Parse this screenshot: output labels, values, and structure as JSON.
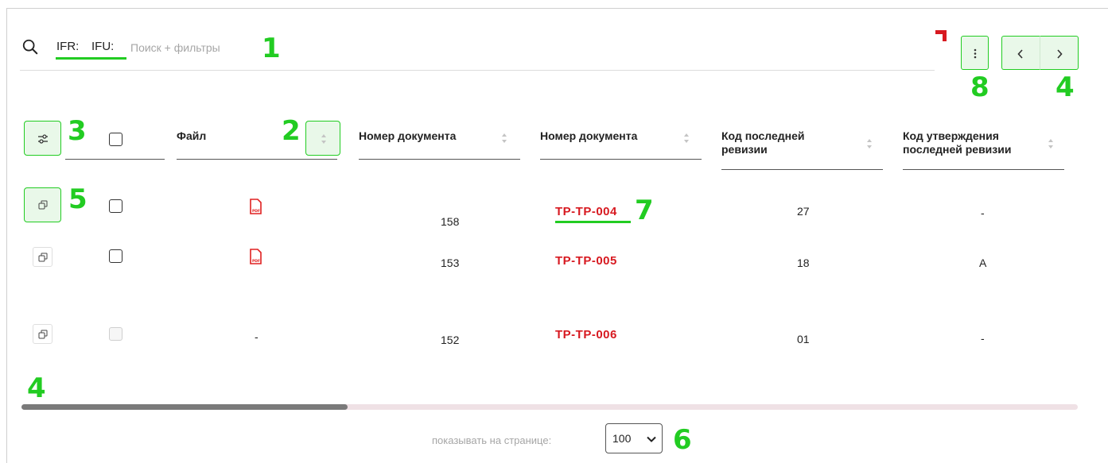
{
  "search": {
    "chips": [
      "IFR:",
      "IFU:"
    ],
    "placeholder": "Поиск + фильтры"
  },
  "annotations": [
    "1",
    "2",
    "3",
    "4",
    "4",
    "5",
    "6",
    "7",
    "8"
  ],
  "toolbar": {
    "more_icon": "more-vertical-icon",
    "prev_icon": "chevron-left-icon",
    "next_icon": "chevron-right-icon"
  },
  "table": {
    "columns": [
      "Файл",
      "Номер документа",
      "Номер документа",
      "Код последней ревизии",
      "Код утверждения последней ревизии"
    ],
    "rows": [
      {
        "file": "pdf",
        "id": "158",
        "doc": "TP-TP-004",
        "rev": "27",
        "approval": "-"
      },
      {
        "file": "pdf",
        "id": "153",
        "doc": "TP-TP-005",
        "rev": "18",
        "approval": "A"
      },
      {
        "file": "-",
        "id": "152",
        "doc": "TP-TP-006",
        "rev": "01",
        "approval": "-"
      }
    ]
  },
  "pager": {
    "label": "показывать на странице:",
    "value": "100"
  },
  "colors": {
    "accent_green": "#22cc22",
    "link_red": "#d71920",
    "pdf_red": "#e02020"
  }
}
